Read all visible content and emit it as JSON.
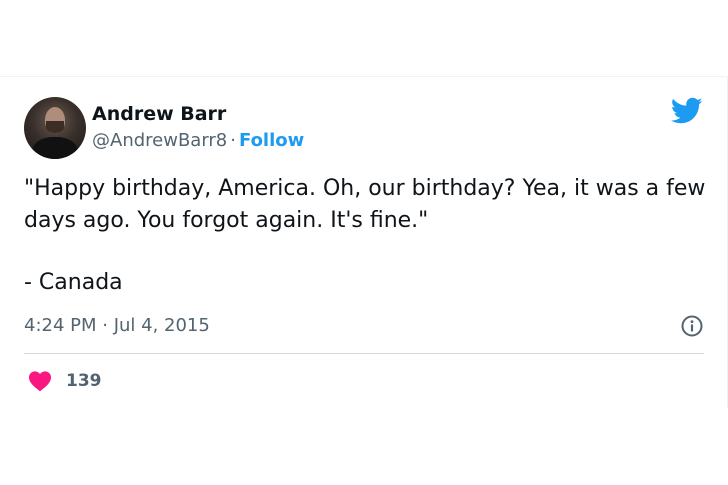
{
  "tweet": {
    "author": {
      "display_name": "Andrew Barr",
      "handle": "@AndrewBarr8",
      "separator": "·",
      "follow_label": "Follow"
    },
    "text_line_1": "\"Happy birthday, America. Oh, our birthday? Yea, it was a few days ago. You forgot again. It's fine.\"",
    "text_line_2": "- Canada",
    "timestamp": "4:24 PM · Jul 4, 2015",
    "likes_count": "139"
  },
  "icons": {
    "brand": "twitter-bird-icon",
    "info": "info-icon",
    "like": "heart-icon"
  },
  "colors": {
    "accent": "#1d9bf0",
    "text": "#0f1419",
    "secondary_text": "#536471",
    "like": "#f91880",
    "divider": "#cfd9de"
  }
}
